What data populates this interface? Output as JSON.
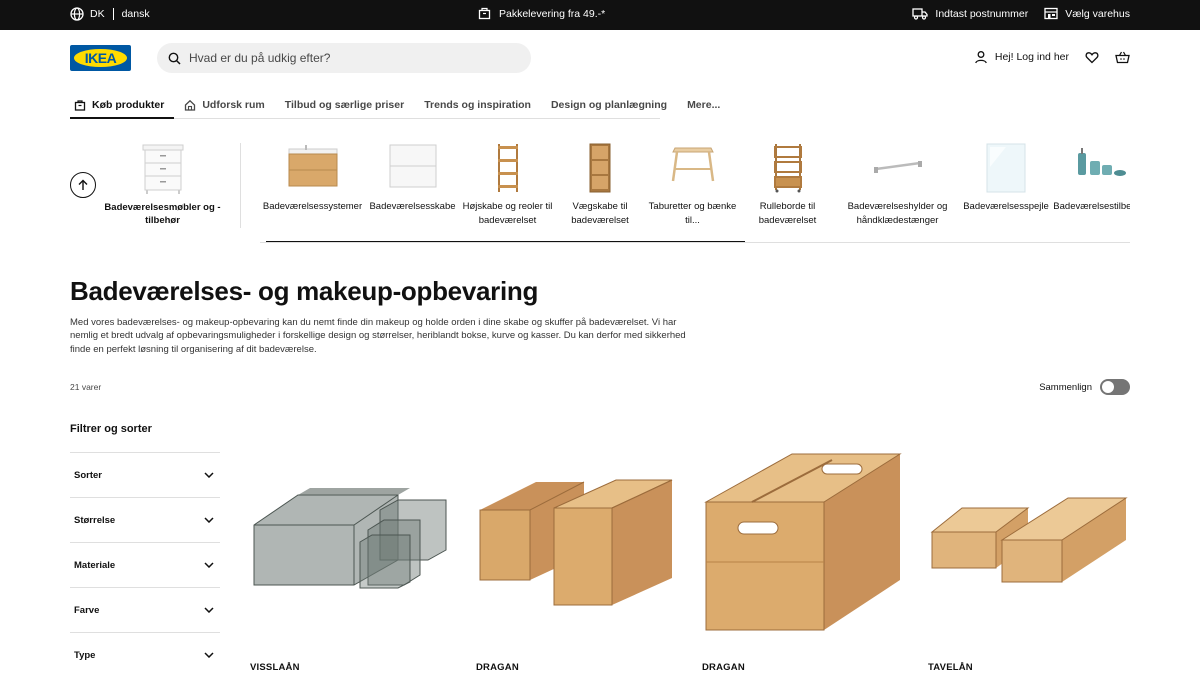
{
  "topbar": {
    "country": "DK",
    "language": "dansk",
    "delivery": "Pakkelevering fra 49.-*",
    "postcode": "Indtast postnummer",
    "store": "Vælg varehus"
  },
  "header": {
    "logo_text": "IKEA",
    "search_placeholder": "Hvad er du på udkig efter?",
    "login": "Hej! Log ind her"
  },
  "nav": {
    "tabs": [
      {
        "label": "Køb produkter",
        "icon": "shopping-bag-icon"
      },
      {
        "label": "Udforsk rum",
        "icon": "home-icon"
      },
      {
        "label": "Tilbud og særlige priser"
      },
      {
        "label": "Trends og inspiration"
      },
      {
        "label": "Design og planlægning"
      },
      {
        "label": "Mere..."
      }
    ]
  },
  "categories": {
    "parent": "Badeværelsesmøbler og -tilbehør",
    "items": [
      {
        "label": "Badeværelsessystemer"
      },
      {
        "label": "Badeværelsesskabe"
      },
      {
        "label": "Højskabe og reoler til badeværelset"
      },
      {
        "label": "Vægskabe til badeværelset"
      },
      {
        "label": "Taburetter og bænke til..."
      },
      {
        "label": "Rulleborde til badeværelset"
      },
      {
        "label": "Badeværelseshylder og håndklædestænger"
      },
      {
        "label": "Badeværelsesspejle"
      },
      {
        "label": "Badeværelsestilbehør"
      }
    ]
  },
  "page": {
    "title": "Badeværelses- og makeup-opbevaring",
    "intro": "Med vores badeværelses- og makeup-opbevaring kan du nemt finde din makeup og holde orden i dine skabe og skuffer på badeværelset. Vi har nemlig et bredt udvalg af opbevaringsmuligheder i forskellige design og størrelser, heriblandt bokse, kurve og kasser. Du kan derfor med sikkerhed finde en perfekt løsning til organisering af dit badeværelse.",
    "count": "21 varer",
    "compare": "Sammenlign"
  },
  "filters": {
    "title": "Filtrer og sorter",
    "items": [
      "Sorter",
      "Størrelse",
      "Materiale",
      "Farve",
      "Type"
    ]
  },
  "products": [
    {
      "name": "VISSLAÅN"
    },
    {
      "name": "DRAGAN"
    },
    {
      "name": "DRAGAN"
    },
    {
      "name": "TAVELÅN"
    }
  ],
  "colors": {
    "topbar": "#111111",
    "ikea_blue": "#0058a3",
    "ikea_yellow": "#ffdb00",
    "bamboo": "#d9a86a"
  }
}
